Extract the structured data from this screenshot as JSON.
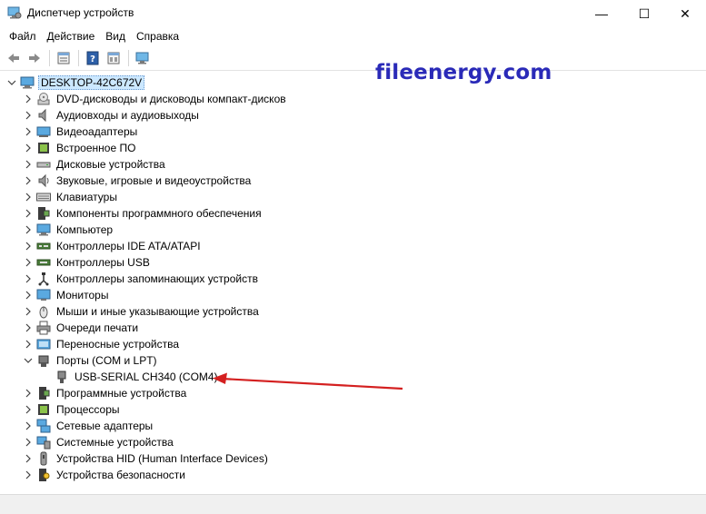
{
  "window": {
    "title": "Диспетчер устройств",
    "controls": {
      "minimize": "—",
      "maximize": "☐",
      "close": "✕"
    }
  },
  "menu": [
    "Файл",
    "Действие",
    "Вид",
    "Справка"
  ],
  "toolbar": {
    "icons": [
      "back-icon",
      "forward-icon",
      "properties-icon",
      "help-icon",
      "show-hide-icon",
      "scan-hardware-icon"
    ]
  },
  "watermark": "fileenergy.com",
  "tree": {
    "root": "DESKTOP-42C672V",
    "items": [
      {
        "label": "DVD-дисководы и дисководы компакт-дисков",
        "icon": "dvd-drive-icon"
      },
      {
        "label": "Аудиовходы и аудиовыходы",
        "icon": "audio-icon"
      },
      {
        "label": "Видеоадаптеры",
        "icon": "display-adapter-icon"
      },
      {
        "label": "Встроенное ПО",
        "icon": "firmware-icon"
      },
      {
        "label": "Дисковые устройства",
        "icon": "disk-drive-icon"
      },
      {
        "label": "Звуковые, игровые и видеоустройства",
        "icon": "sound-icon"
      },
      {
        "label": "Клавиатуры",
        "icon": "keyboard-icon"
      },
      {
        "label": "Компоненты программного обеспечения",
        "icon": "software-component-icon"
      },
      {
        "label": "Компьютер",
        "icon": "computer-icon"
      },
      {
        "label": "Контроллеры IDE ATA/ATAPI",
        "icon": "ide-controller-icon"
      },
      {
        "label": "Контроллеры USB",
        "icon": "usb-controller-icon"
      },
      {
        "label": "Контроллеры запоминающих устройств",
        "icon": "storage-controller-icon"
      },
      {
        "label": "Мониторы",
        "icon": "monitor-icon"
      },
      {
        "label": "Мыши и иные указывающие устройства",
        "icon": "mouse-icon"
      },
      {
        "label": "Очереди печати",
        "icon": "print-queue-icon"
      },
      {
        "label": "Переносные устройства",
        "icon": "portable-device-icon"
      },
      {
        "label": "Порты (COM и LPT)",
        "icon": "port-icon",
        "expanded": true,
        "children": [
          {
            "label": "USB-SERIAL CH340 (COM4)",
            "icon": "serial-port-icon"
          }
        ]
      },
      {
        "label": "Программные устройства",
        "icon": "software-device-icon"
      },
      {
        "label": "Процессоры",
        "icon": "processor-icon"
      },
      {
        "label": "Сетевые адаптеры",
        "icon": "network-adapter-icon"
      },
      {
        "label": "Системные устройства",
        "icon": "system-device-icon"
      },
      {
        "label": "Устройства HID (Human Interface Devices)",
        "icon": "hid-icon"
      },
      {
        "label": "Устройства безопасности",
        "icon": "security-device-icon"
      }
    ]
  },
  "colors": {
    "root_selection": "#cce8ff",
    "watermark": "#2a2ab8",
    "arrow": "#d42020"
  }
}
